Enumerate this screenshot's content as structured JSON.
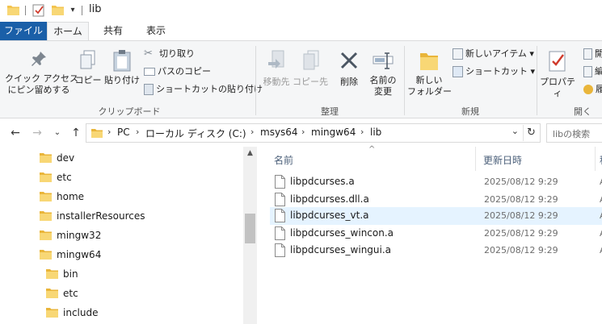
{
  "window": {
    "title": "lib"
  },
  "tabs": {
    "file": "ファイル",
    "home": "ホーム",
    "share": "共有",
    "view": "表示"
  },
  "ribbon": {
    "pin_quick_access": "クイック アクセス\nにピン留めする",
    "copy": "コピー",
    "paste": "貼り付け",
    "cut": "切り取り",
    "copy_path": "パスのコピー",
    "paste_shortcut": "ショートカットの貼り付け",
    "clipboard_group": "クリップボード",
    "move_to": "移動先",
    "copy_to": "コピー先",
    "delete": "削除",
    "rename": "名前の\n変更",
    "organize_group": "整理",
    "new_folder": "新しい\nフォルダー",
    "new_item": "新しいアイテム",
    "easy_access": "ショートカット",
    "new_group": "新規",
    "properties": "プロパティ",
    "open_group": "開く",
    "open_partial": "開",
    "edit_partial": "編",
    "history_partial": "履"
  },
  "address": {
    "crumbs": [
      "PC",
      "ローカル ディスク (C:)",
      "msys64",
      "mingw64",
      "lib"
    ],
    "search_placeholder": "libの検索"
  },
  "nav_tree": {
    "items": [
      {
        "label": "dev",
        "level": 0
      },
      {
        "label": "etc",
        "level": 0
      },
      {
        "label": "home",
        "level": 0
      },
      {
        "label": "installerResources",
        "level": 0
      },
      {
        "label": "mingw32",
        "level": 0
      },
      {
        "label": "mingw64",
        "level": 0
      },
      {
        "label": "bin",
        "level": 1
      },
      {
        "label": "etc",
        "level": 1
      },
      {
        "label": "include",
        "level": 1
      }
    ]
  },
  "file_list": {
    "columns": {
      "name": "名前",
      "date": "更新日時",
      "type": "種"
    },
    "rows": [
      {
        "name": "libpdcurses.a",
        "date": "2025/08/12 9:29",
        "type": "A",
        "selected": false
      },
      {
        "name": "libpdcurses.dll.a",
        "date": "2025/08/12 9:29",
        "type": "A",
        "selected": false
      },
      {
        "name": "libpdcurses_vt.a",
        "date": "2025/08/12 9:29",
        "type": "A",
        "selected": true
      },
      {
        "name": "libpdcurses_wincon.a",
        "date": "2025/08/12 9:29",
        "type": "A",
        "selected": false
      },
      {
        "name": "libpdcurses_wingui.a",
        "date": "2025/08/12 9:29",
        "type": "A",
        "selected": false
      }
    ]
  },
  "colors": {
    "file_tab": "#1a5fa8",
    "folder": "#f3c44f",
    "selection": "#e5f3ff"
  }
}
